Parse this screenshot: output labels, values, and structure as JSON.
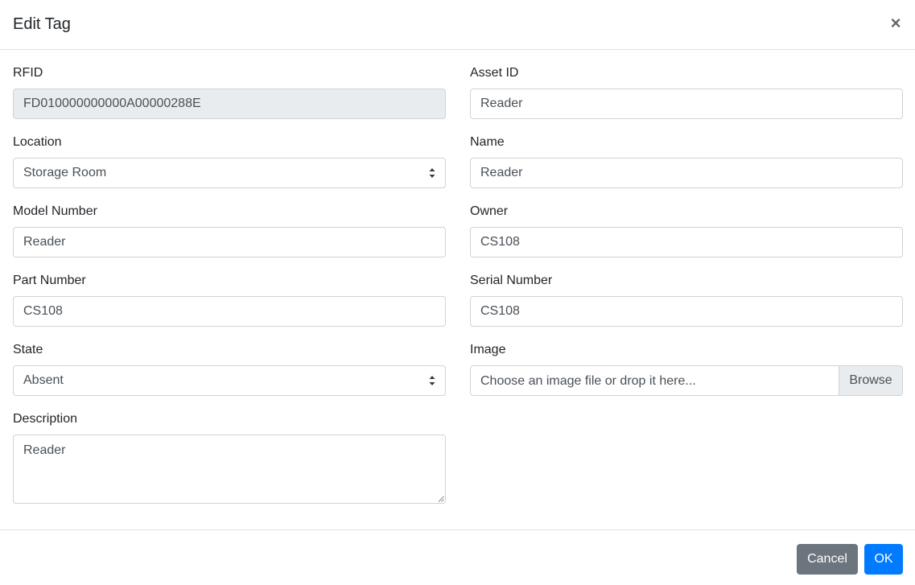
{
  "dialog": {
    "title": "Edit Tag",
    "close_label": "×"
  },
  "fields": {
    "rfid": {
      "label": "RFID",
      "value": "FD010000000000A00000288E"
    },
    "asset_id": {
      "label": "Asset ID",
      "value": "Reader"
    },
    "location": {
      "label": "Location",
      "value": "Storage Room"
    },
    "name": {
      "label": "Name",
      "value": "Reader"
    },
    "model_number": {
      "label": "Model Number",
      "value": "Reader"
    },
    "owner": {
      "label": "Owner",
      "value": "CS108"
    },
    "part_number": {
      "label": "Part Number",
      "value": "CS108"
    },
    "serial_number": {
      "label": "Serial Number",
      "value": "CS108"
    },
    "state": {
      "label": "State",
      "value": "Absent"
    },
    "image": {
      "label": "Image",
      "placeholder": "Choose an image file or drop it here...",
      "browse_label": "Browse"
    },
    "description": {
      "label": "Description",
      "value": "Reader"
    }
  },
  "footer": {
    "cancel_label": "Cancel",
    "ok_label": "OK"
  },
  "colors": {
    "primary": "#007bff",
    "secondary": "#6c757d",
    "readonly_bg": "#e9ecef"
  }
}
